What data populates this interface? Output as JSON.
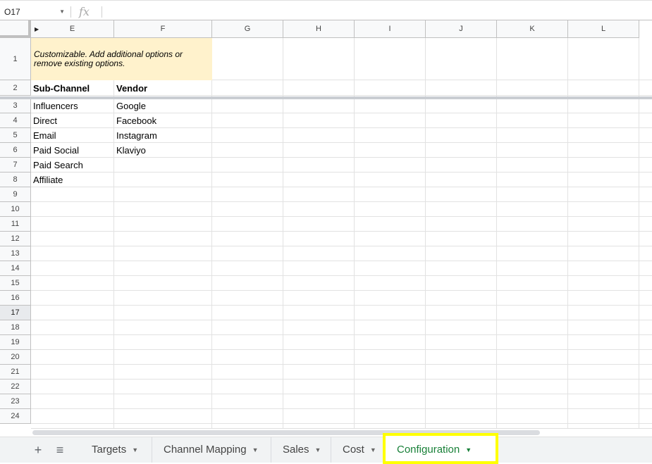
{
  "formula_bar": {
    "cell_ref": "O17",
    "fx_label": "fx",
    "value": ""
  },
  "columns": [
    "E",
    "F",
    "G",
    "H",
    "I",
    "J",
    "K",
    "L"
  ],
  "rows": [
    "1",
    "2",
    "3",
    "4",
    "5",
    "6",
    "7",
    "8",
    "9",
    "10",
    "11",
    "12",
    "13",
    "14",
    "15",
    "16",
    "17",
    "18",
    "19",
    "20",
    "21",
    "22",
    "23",
    "24"
  ],
  "selected_row": "17",
  "note": "Customizable. Add additional options or remove existing options.",
  "headers": {
    "sub_channel": "Sub-Channel",
    "vendor": "Vendor"
  },
  "sub_channels": [
    "Influencers",
    "Direct",
    "Email",
    "Paid Social",
    "Paid Search",
    "Affiliate"
  ],
  "vendors": [
    "Google",
    "Facebook",
    "Instagram",
    "Klaviyo"
  ],
  "colors": {
    "note_fill": "#fff2cc",
    "active_tab_text": "#188038",
    "highlight_box": "#ffff00"
  },
  "tabs": [
    {
      "label": "Targets"
    },
    {
      "label": "Channel Mapping"
    },
    {
      "label": "Sales"
    },
    {
      "label": "Cost"
    },
    {
      "label": "Configuration",
      "active": true
    }
  ],
  "tab_controls": {
    "add": "+",
    "all_sheets": "≡"
  }
}
